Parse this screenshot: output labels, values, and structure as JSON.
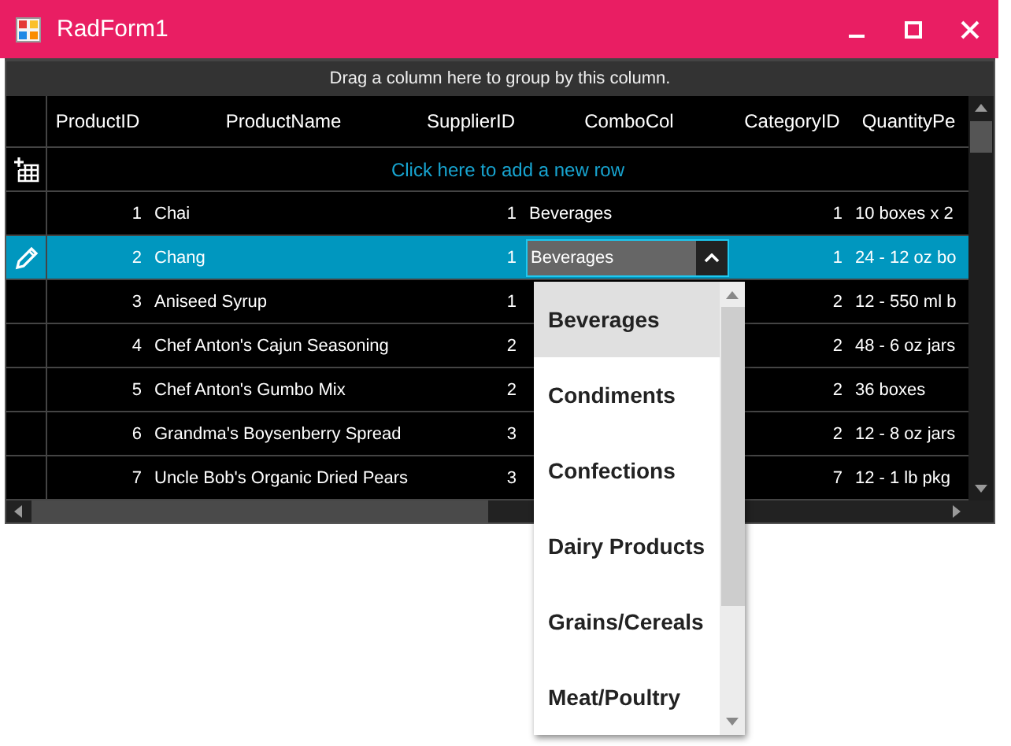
{
  "window": {
    "title": "RadForm1"
  },
  "group_panel": {
    "text": "Drag a column here to group by this column."
  },
  "columns": [
    "ProductID",
    "ProductName",
    "SupplierID",
    "ComboCol",
    "CategoryID",
    "QuantityPe"
  ],
  "new_row": {
    "text": "Click here to add a new row"
  },
  "rows": [
    {
      "selected": false,
      "editing": false,
      "cells": [
        "1",
        "Chai",
        "1",
        "Beverages",
        "1",
        "10 boxes x 2"
      ]
    },
    {
      "selected": true,
      "editing": true,
      "cells": [
        "2",
        "Chang",
        "1",
        null,
        "1",
        "24 - 12 oz bo"
      ],
      "combo_editor": {
        "value": "Beverages",
        "open": true
      }
    },
    {
      "selected": false,
      "editing": false,
      "cells": [
        "3",
        "Aniseed Syrup",
        "1",
        null,
        "2",
        "12 - 550 ml b"
      ]
    },
    {
      "selected": false,
      "editing": false,
      "cells": [
        "4",
        "Chef Anton's Cajun Seasoning",
        "2",
        null,
        "2",
        "48 - 6 oz jars"
      ]
    },
    {
      "selected": false,
      "editing": false,
      "cells": [
        "5",
        "Chef Anton's Gumbo Mix",
        "2",
        null,
        "2",
        "36 boxes"
      ]
    },
    {
      "selected": false,
      "editing": false,
      "cells": [
        "6",
        "Grandma's Boysenberry Spread",
        "3",
        null,
        "2",
        "12 - 8 oz jars"
      ]
    },
    {
      "selected": false,
      "editing": false,
      "cells": [
        "7",
        "Uncle Bob's Organic Dried Pears",
        "3",
        null,
        "7",
        "12 - 1 lb pkg"
      ]
    }
  ],
  "dropdown": {
    "items": [
      {
        "label": "Beverages",
        "selected": true
      },
      {
        "label": "Condiments",
        "selected": false
      },
      {
        "label": "Confections",
        "selected": false
      },
      {
        "label": "Dairy Products",
        "selected": false
      },
      {
        "label": "Grains/Cereals",
        "selected": false
      },
      {
        "label": "Meat/Poultry",
        "selected": false
      }
    ]
  }
}
